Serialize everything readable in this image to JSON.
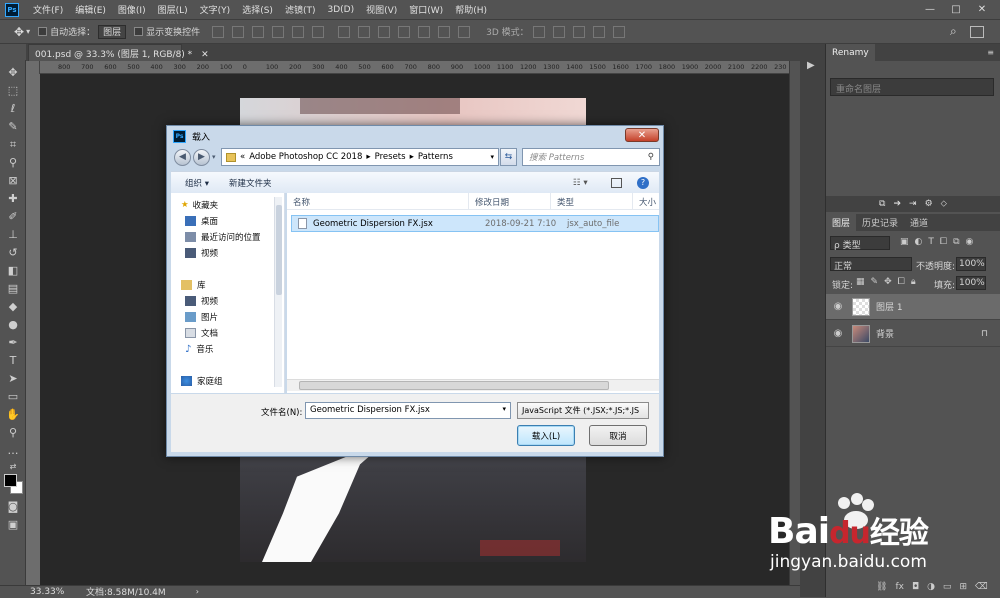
{
  "app": {
    "menus": [
      "文件(F)",
      "编辑(E)",
      "图像(I)",
      "图层(L)",
      "文字(Y)",
      "选择(S)",
      "滤镜(T)",
      "3D(D)",
      "视图(V)",
      "窗口(W)",
      "帮助(H)"
    ],
    "window_controls": [
      "—",
      "□",
      "✕"
    ]
  },
  "options_bar": {
    "auto_select_label": "自动选择：",
    "auto_select_value": "图层",
    "show_transform_label": "显示变换控件",
    "mode_3d_label": "3D 模式："
  },
  "document": {
    "tab_title": "001.psd @ 33.3% (图层 1, RGB/8) *",
    "ruler_ticks": [
      "800",
      "700",
      "600",
      "500",
      "400",
      "300",
      "200",
      "100",
      "0",
      "100",
      "200",
      "300",
      "400",
      "500",
      "600",
      "700",
      "800",
      "900",
      "1000",
      "1100",
      "1200",
      "1300",
      "1400",
      "1500",
      "1600",
      "1700",
      "1800",
      "1900",
      "2000",
      "2100",
      "2200",
      "230"
    ]
  },
  "status": {
    "zoom": "33.33%",
    "doc_size": "文档:8.58M/10.4M"
  },
  "renamy": {
    "title": "Renamy",
    "placeholder": "重命名图层"
  },
  "layers_panel": {
    "tabs": [
      "图层",
      "历史记录",
      "通道"
    ],
    "filter_label": "ρ 类型",
    "blend_mode": "正常",
    "opacity_label": "不透明度:",
    "opacity_value": "100%",
    "lock_label": "锁定:",
    "fill_label": "填充:",
    "fill_value": "100%",
    "layers": [
      {
        "name": "图层 1",
        "selected": true
      },
      {
        "name": "背景",
        "selected": false
      }
    ]
  },
  "dialog": {
    "title": "载入",
    "address": {
      "prefix": "«",
      "crumbs": [
        "Adobe Photoshop CC 2018",
        "Presets",
        "Patterns"
      ]
    },
    "search_placeholder": "搜索 Patterns",
    "organize_label": "组织 ▾",
    "new_folder_label": "新建文件夹",
    "nav": {
      "favorites": "收藏夹",
      "fav_items": [
        "桌面",
        "最近访问的位置",
        "视频"
      ],
      "library": "库",
      "lib_items": [
        "视频",
        "图片",
        "文档",
        "音乐"
      ],
      "homegroup": "家庭组"
    },
    "columns": [
      "名称",
      "修改日期",
      "类型",
      "大小"
    ],
    "file": {
      "name": "Geometric Dispersion FX.jsx",
      "date": "2018-09-21 7:10",
      "type": "jsx_auto_file"
    },
    "filename_label": "文件名(N):",
    "filename_value": "Geometric Dispersion FX.jsx",
    "filetype_value": "JavaScript 文件 (*.JSX;*.JS;*.JS",
    "load_button": "载入(L)",
    "cancel_button": "取消"
  },
  "watermark": {
    "brand": "Bai",
    "brand2": "经验",
    "url": "jingyan.baidu.com"
  },
  "colors": {
    "ps_bg": "#535353",
    "canvas_bg": "#282828",
    "dialog_frame": "#c9d9ea",
    "selection": "#cde6fb"
  }
}
